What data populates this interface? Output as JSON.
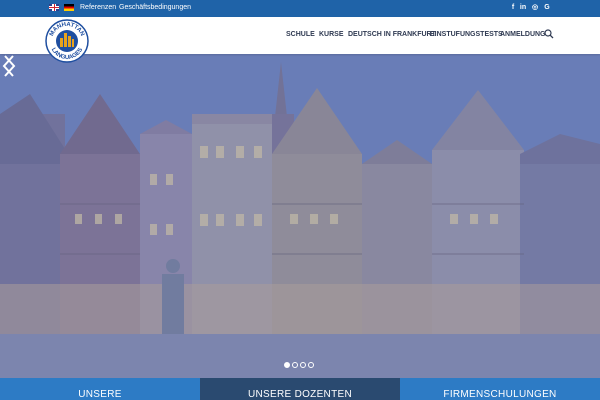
{
  "topbar": {
    "languages": [
      {
        "name": "uk-flag-icon",
        "label": "English"
      },
      {
        "name": "de-flag-icon",
        "label": "Deutsch"
      }
    ],
    "links": [
      "Referenzen",
      "Geschäftsbedingungen"
    ],
    "social": [
      "f",
      "in",
      "◎",
      "G"
    ]
  },
  "brand": {
    "logo_text_top": "MANHATTAN",
    "logo_text_bottom": "LANGUAGES"
  },
  "nav": {
    "items": [
      "SCHULE",
      "KURSE",
      "DEUTSCH IN FRANKFURT",
      "EINSTUFUNGSTESTS",
      "ANMELDUNG"
    ]
  },
  "slider": {
    "slide_count": 4,
    "active_slide": 1
  },
  "tabs": [
    "UNSERE",
    "UNSERE DOZENTEN",
    "FIRMENSCHULUNGEN"
  ],
  "colors": {
    "topbar": "#1f63a8",
    "nav_text": "#2f3a52",
    "tab_blue": "#2d7bc5",
    "tab_dark": "#2a4a70",
    "logo_blue": "#1f4fa0",
    "logo_gold": "#e8a21c"
  }
}
